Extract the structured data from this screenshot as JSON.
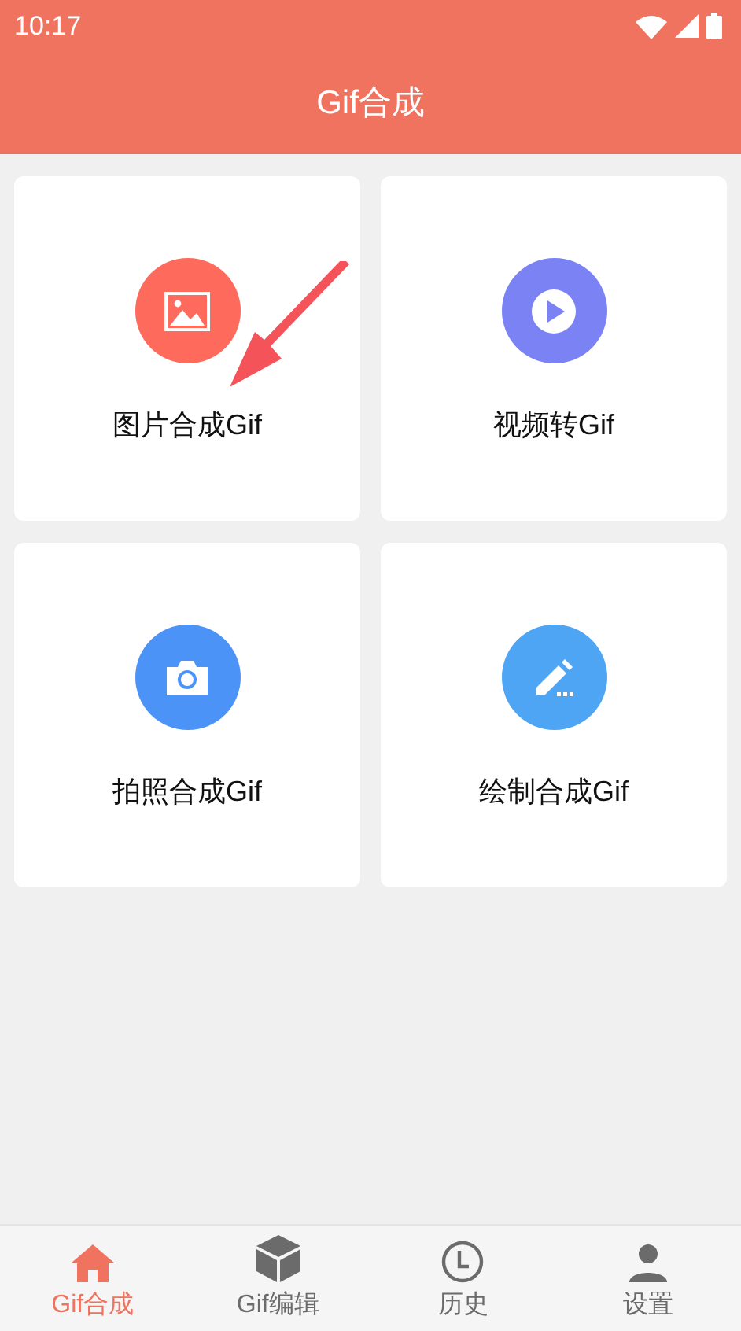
{
  "status_bar": {
    "time": "10:17"
  },
  "header": {
    "title": "Gif合成"
  },
  "cards": [
    {
      "kind": "image",
      "label": "图片合成Gif",
      "color": "#fe6a5c",
      "pointer": true
    },
    {
      "kind": "video",
      "label": "视频转Gif",
      "color": "#7b82f4",
      "pointer": false
    },
    {
      "kind": "camera",
      "label": "拍照合成Gif",
      "color": "#4c93f7",
      "pointer": false
    },
    {
      "kind": "draw",
      "label": "绘制合成Gif",
      "color": "#4ea5f3",
      "pointer": false
    }
  ],
  "tabs": [
    {
      "kind": "home",
      "label": "Gif合成",
      "selected": true
    },
    {
      "kind": "cube",
      "label": "Gif编辑",
      "selected": false
    },
    {
      "kind": "clock",
      "label": "历史",
      "selected": false
    },
    {
      "kind": "user",
      "label": "设置",
      "selected": false
    }
  ]
}
